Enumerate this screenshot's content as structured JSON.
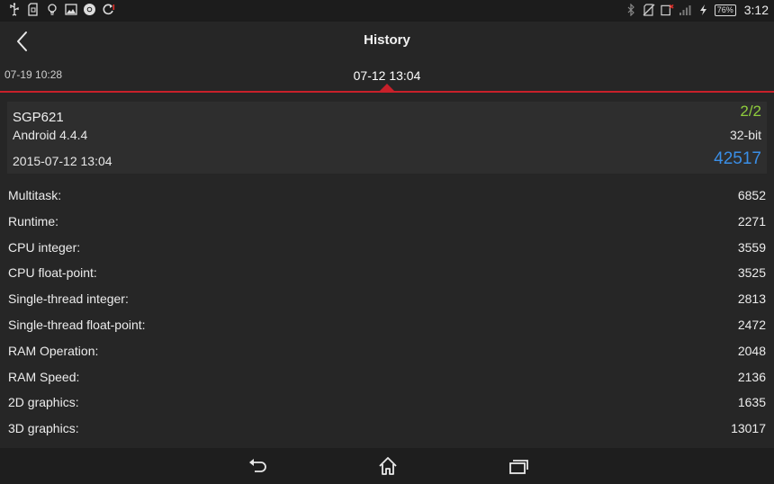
{
  "status_bar": {
    "left_icons": [
      "usb-icon",
      "sd-card-icon",
      "lightbulb-icon",
      "image-icon",
      "chrome-icon",
      "sync-alert-icon"
    ],
    "right_icons": [
      "bluetooth-icon",
      "no-sim-icon",
      "data-no-signal-icon",
      "signal-icon",
      "charging-icon"
    ],
    "battery": "76%",
    "time": "3:12"
  },
  "header": {
    "title": "History"
  },
  "date_tabs": {
    "previous": "07-19 10:28",
    "active": "07-12 13:04"
  },
  "summary": {
    "device": "SGP621",
    "os": "Android 4.4.4",
    "date": "2015-07-12 13:04",
    "rank": "2/2",
    "arch": "32-bit",
    "total": "42517"
  },
  "scores": [
    {
      "label": "Multitask:",
      "value": "6852"
    },
    {
      "label": "Runtime:",
      "value": "2271"
    },
    {
      "label": "CPU integer:",
      "value": "3559"
    },
    {
      "label": "CPU float-point:",
      "value": "3525"
    },
    {
      "label": "Single-thread integer:",
      "value": "2813"
    },
    {
      "label": "Single-thread float-point:",
      "value": "2472"
    },
    {
      "label": "RAM Operation:",
      "value": "2048"
    },
    {
      "label": "RAM Speed:",
      "value": "2136"
    },
    {
      "label": "2D graphics:",
      "value": "1635"
    },
    {
      "label": "3D graphics:",
      "value": "13017"
    }
  ],
  "nav_bar": {
    "icons": [
      "back-icon",
      "home-icon",
      "recent-apps-icon"
    ]
  },
  "colors": {
    "accent_red": "#c8202a",
    "rank_green": "#8fcc3c",
    "score_blue": "#3a8ee6",
    "background": "#262626"
  }
}
